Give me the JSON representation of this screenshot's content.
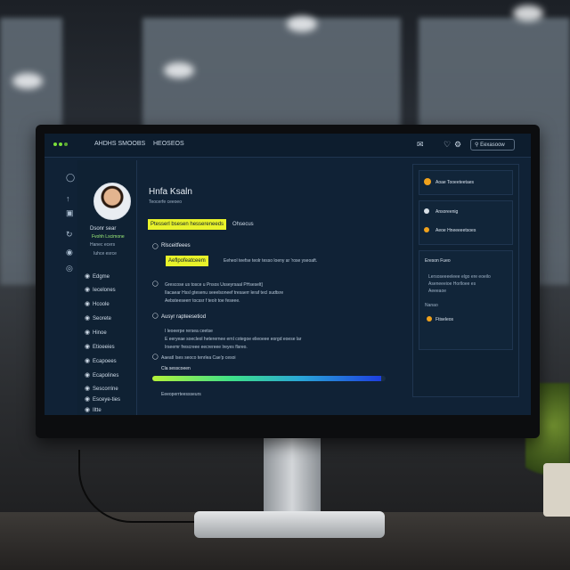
{
  "app": {
    "brand": "AHDHS SMOOBS",
    "nav_item": "HEOSEOS",
    "topbar_button": "Eexasoow"
  },
  "profile": {
    "name": "Dsonr sear",
    "role": "Fvohh Lscimone",
    "meta_1": "Hanec ecers",
    "meta_2": "Iuhce esrce"
  },
  "sidebar": {
    "items": [
      {
        "icon": "home-icon",
        "label": "Edgme"
      },
      {
        "icon": "user-icon",
        "label": "Iecelones"
      },
      {
        "icon": "chart-icon",
        "label": "Hcoole"
      },
      {
        "icon": "grid-icon",
        "label": "Seorete"
      },
      {
        "icon": "star-icon",
        "label": "Hinoe"
      },
      {
        "icon": "list-icon",
        "label": "Etioeeies"
      },
      {
        "icon": "settings-icon",
        "label": "Ecapoees"
      },
      {
        "icon": "folder-icon",
        "label": "Ecapolines"
      },
      {
        "icon": "link-icon",
        "label": "Sescorrine"
      },
      {
        "icon": "key-icon",
        "label": "Esceye-ties"
      },
      {
        "icon": "help-icon",
        "label": "Iltte"
      }
    ]
  },
  "main": {
    "title": "Hnfa Ksaln",
    "subtitle": "Teocerfe ceeoeo",
    "tag_primary": "Ptesserl bsesen hessereneeds",
    "tag_secondary": "Ohsecus",
    "section_1": {
      "title": "Rlsceitfeees",
      "tag": "Aeflpofeatceem",
      "text": "Eeheol teefse teolr tesso loeny ar 'rose yseoaft."
    },
    "section_2": {
      "line_1": "Grescose us tosce u Pnsos Usseyrsaal PHseselt]",
      "line_2": "Ilacaear Hssl gtesenu seeelsoneef tresaerr leraf tecl sudtsre",
      "line_3": "Aebsteeseerr tocssr f teolr toe feseee."
    },
    "section_3": {
      "title": "Ausyr rapteesetiod",
      "line_1": "I leoeerpe rersea ceetse",
      "line_2": "E eeryeae soecleol heterernee ernl cotegoe elieoeee eorgd eoese lar",
      "line_3": "Irseemr frescreee eecrereee lreyes flsreo."
    },
    "progress": {
      "title": "Aaeatl Ises seoco tenrlea Cae'p cesoi",
      "label": "Cla sesscoeen",
      "value": 0.98,
      "footer": "Eeeoperrteessseurs"
    }
  },
  "right_panel": {
    "card_1": "Aoae Tooeeteetaes",
    "card_2": "Ansoreenig",
    "card_3": "Aeoe Hneeeeetsoes",
    "notes": {
      "title": "Ereson Fueo",
      "line_1": "Lersoseeeeleee elgo ere eoeilo",
      "line_2": "Aseneeeioe Horlloee es",
      "line_3": "Aeeeaoe",
      "link_label": "Nanao",
      "action": "Ftiseleos"
    }
  },
  "colors": {
    "accent_yellow": "#e8f22a",
    "accent_green": "#7be03a",
    "screen_bg": "#102236"
  }
}
